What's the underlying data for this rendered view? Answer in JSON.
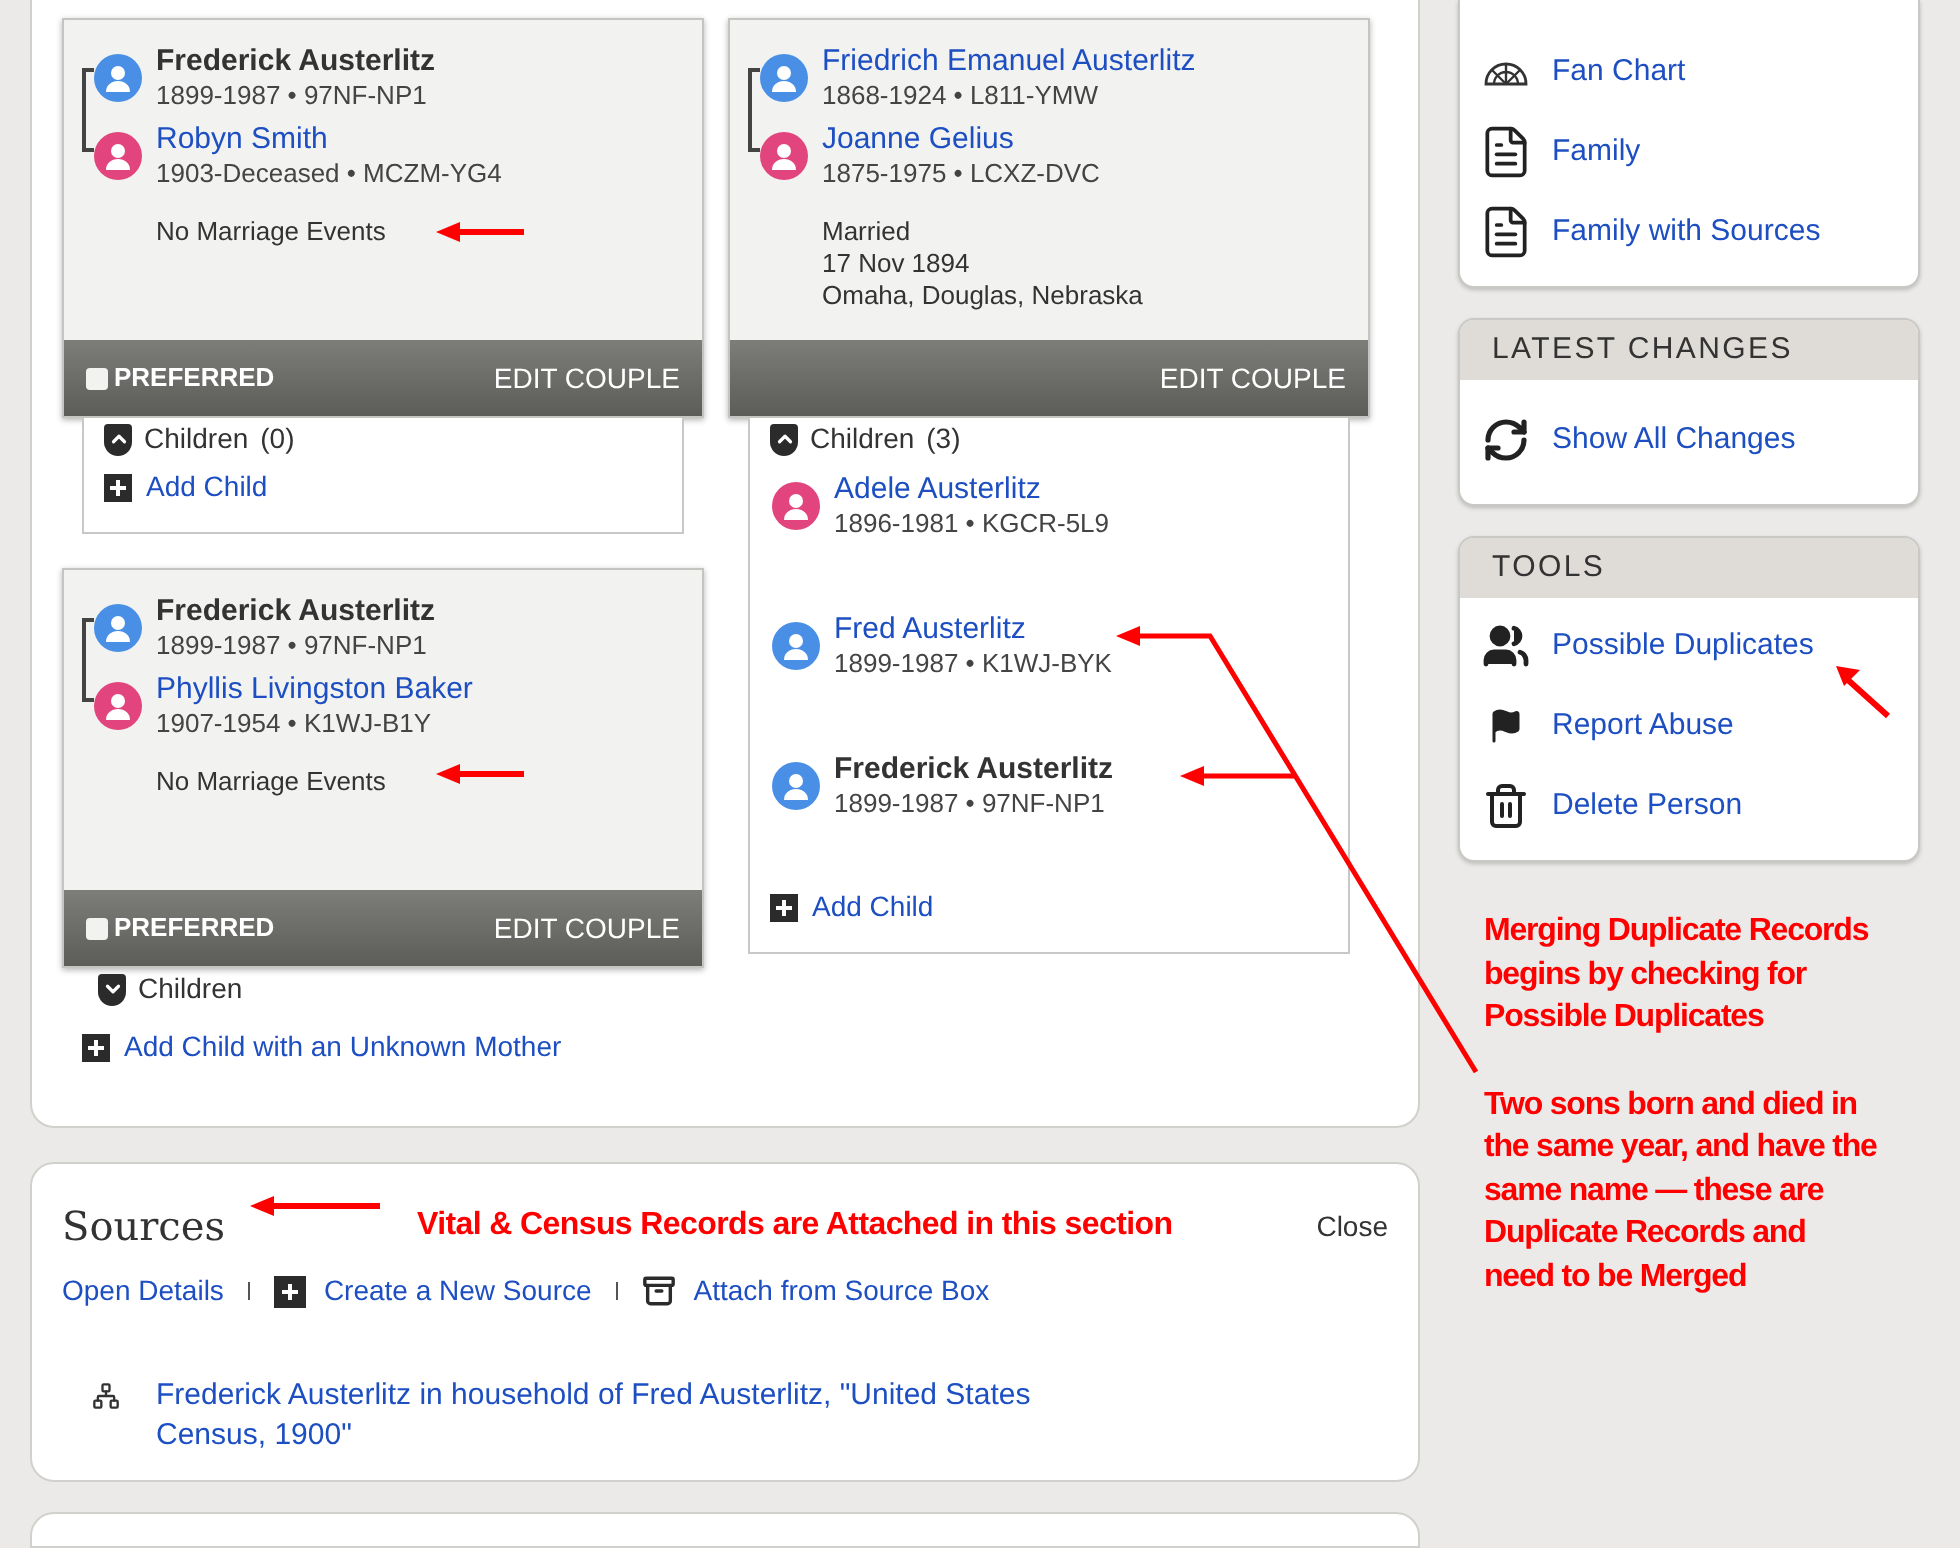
{
  "family_panel": {
    "couples": [
      {
        "persons": [
          {
            "name": "Frederick Austerlitz",
            "kind": "current",
            "color": "#4a8fe6",
            "details": "1899-1987 • 97NF-NP1"
          },
          {
            "name": "Robyn Smith",
            "kind": "link",
            "color": "#e2457d",
            "details": "1903-Deceased • MCZM-YG4"
          }
        ],
        "events": [
          "No Marriage Events"
        ],
        "preferred": {
          "label": "PREFERRED",
          "checked": false
        },
        "edit_button": "EDIT COUPLE",
        "children": {
          "label": "Children",
          "count": "(0)",
          "expanded": true,
          "add_label": "Add Child"
        }
      },
      {
        "persons": [
          {
            "name": "Friedrich Emanuel Austerlitz",
            "kind": "link",
            "color": "#4a8fe6",
            "details": "1868-1924 • L811-YMW"
          },
          {
            "name": "Joanne Gelius",
            "kind": "link",
            "color": "#e2457d",
            "details": "1875-1975 • LCXZ-DVC"
          }
        ],
        "events": [
          "Married",
          "17 Nov 1894",
          "Omaha, Douglas, Nebraska"
        ],
        "edit_button": "EDIT COUPLE",
        "children": {
          "label": "Children",
          "count": "(3)",
          "expanded": true,
          "items": [
            {
              "name": "Adele Austerlitz",
              "kind": "link",
              "color": "#e2457d",
              "details": "1896-1981 • KGCR-5L9"
            },
            {
              "name": "Fred Austerlitz",
              "kind": "link",
              "color": "#4a8fe6",
              "details": "1899-1987 • K1WJ-BYK"
            },
            {
              "name": "Frederick Austerlitz",
              "kind": "current",
              "color": "#4a8fe6",
              "details": "1899-1987 • 97NF-NP1"
            }
          ],
          "add_label": "Add Child"
        }
      },
      {
        "persons": [
          {
            "name": "Frederick Austerlitz",
            "kind": "current",
            "color": "#4a8fe6",
            "details": "1899-1987 • 97NF-NP1"
          },
          {
            "name": "Phyllis Livingston Baker",
            "kind": "link",
            "color": "#e2457d",
            "details": "1907-1954 • K1WJ-B1Y"
          }
        ],
        "events": [
          "No Marriage Events"
        ],
        "preferred": {
          "label": "PREFERRED",
          "checked": false
        },
        "edit_button": "EDIT COUPLE",
        "children": {
          "label": "Children",
          "expanded": false
        }
      }
    ],
    "add_unknown_mother": "Add Child with an Unknown Mother"
  },
  "sources": {
    "title": "Sources",
    "note": "Vital & Census Records are Attached in this section",
    "close": "Close",
    "actions": [
      "Open Details",
      "Create a New Source",
      "Attach from Source Box"
    ],
    "items": [
      "Frederick Austerlitz in household of Fred Austerlitz, \"United States Census, 1900\""
    ]
  },
  "sidebar": {
    "panels": [
      {
        "items": [
          "Fan Chart",
          "Family",
          "Family with Sources"
        ]
      },
      {
        "title": "LATEST CHANGES",
        "items": [
          "Show All Changes"
        ]
      },
      {
        "title": "TOOLS",
        "items": [
          "Possible Duplicates",
          "Report Abuse",
          "Delete Person"
        ]
      }
    ],
    "notes": [
      "Merging Duplicate Records begins by checking for Possible Duplicates",
      "Two sons born and died in the same year, and have the same name — these are Duplicate Records and need to be Merged"
    ]
  }
}
